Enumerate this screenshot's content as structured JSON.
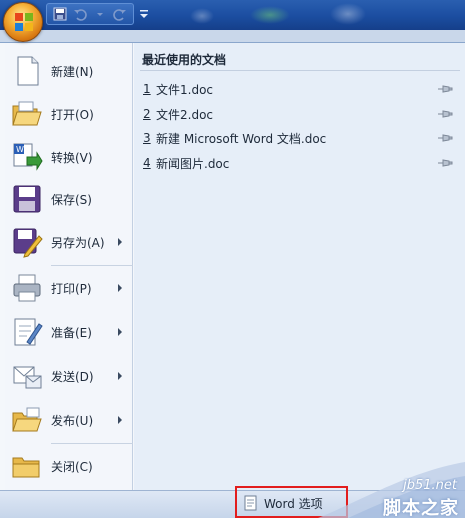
{
  "titlebar": {
    "office_button": "Office button",
    "quick_access": [
      "save-icon",
      "undo-icon",
      "redo-icon"
    ]
  },
  "menu": {
    "items": [
      {
        "label": "新建(N)",
        "icon": "new-document-icon",
        "submenu": false
      },
      {
        "label": "打开(O)",
        "icon": "open-folder-icon",
        "submenu": false
      },
      {
        "label": "转换(V)",
        "icon": "convert-icon",
        "submenu": false
      },
      {
        "label": "保存(S)",
        "icon": "save-icon",
        "submenu": false
      },
      {
        "label": "另存为(A)",
        "icon": "save-as-icon",
        "submenu": true
      },
      {
        "label": "打印(P)",
        "icon": "print-icon",
        "submenu": true
      },
      {
        "label": "准备(E)",
        "icon": "prepare-icon",
        "submenu": true
      },
      {
        "label": "发送(D)",
        "icon": "send-icon",
        "submenu": true
      },
      {
        "label": "发布(U)",
        "icon": "publish-icon",
        "submenu": true
      },
      {
        "label": "关闭(C)",
        "icon": "close-folder-icon",
        "submenu": false
      }
    ]
  },
  "recent": {
    "title": "最近使用的文档",
    "documents": [
      {
        "number": "1",
        "name": "文件1.doc"
      },
      {
        "number": "2",
        "name": "文件2.doc"
      },
      {
        "number": "3",
        "name": "新建 Microsoft Word 文档.doc"
      },
      {
        "number": "4",
        "name": "新闻图片.doc"
      }
    ]
  },
  "bottom": {
    "word_options_label": "Word 选项"
  },
  "watermark": {
    "url": "jb51.net",
    "text": "脚本之家"
  },
  "colors": {
    "titlebar": "#1b4da0",
    "highlight_box": "#e21d1d",
    "menu_bg": "#f4f7fb",
    "recent_bg": "#e6eef8"
  }
}
